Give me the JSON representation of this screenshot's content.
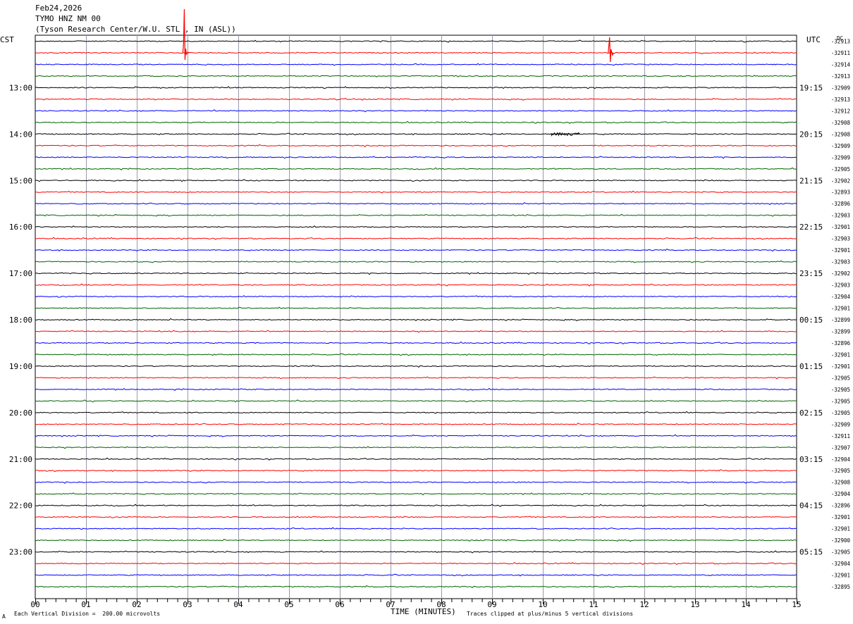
{
  "header": {
    "date": "Feb24,2026",
    "station": "TYMO HNZ NM 00",
    "location": "(Tyson Research Center/W.U. STL , IN (ASL))"
  },
  "left_tz": "CST",
  "right_tz": "UTC",
  "dc_label": "DC",
  "footer": {
    "scale_note": "Each Vertical Division =  200.00 microvolts",
    "clip_note": "Traces clipped at plus/minus 5 vertical divisions",
    "corner_mark": "A"
  },
  "chart_data": {
    "type": "line",
    "title": "",
    "xlabel": "TIME (MINUTES)",
    "xlim": [
      0,
      15
    ],
    "x_ticks": [
      "00",
      "01",
      "02",
      "03",
      "04",
      "05",
      "06",
      "07",
      "08",
      "09",
      "10",
      "11",
      "12",
      "13",
      "14",
      "15"
    ],
    "row_count": 48,
    "trace_color_cycle": [
      "#000000",
      "#ff0000",
      "#0000ff",
      "#006400"
    ],
    "left_hour_labels": [
      "13:00",
      "14:00",
      "15:00",
      "16:00",
      "17:00",
      "18:00",
      "19:00",
      "20:00",
      "21:00",
      "22:00",
      "23:00"
    ],
    "right_hour_labels": [
      "19:15",
      "20:15",
      "21:15",
      "22:15",
      "23:15",
      "00:15",
      "01:15",
      "02:15",
      "03:15",
      "04:15",
      "05:15"
    ],
    "dc_offsets": [
      "-32913",
      "-32911",
      "-32914",
      "-32913",
      "-32909",
      "-32913",
      "-32912",
      "-32908",
      "-32908",
      "-32909",
      "-32909",
      "-32905",
      "-32902",
      "-32893",
      "-32896",
      "-32903",
      "-32901",
      "-32903",
      "-32901",
      "-32903",
      "-32902",
      "-32903",
      "-32904",
      "-32901",
      "-32899",
      "-32899",
      "-32896",
      "-32901",
      "-32901",
      "-32905",
      "-32905",
      "-32905",
      "-32905",
      "-32909",
      "-32911",
      "-32907",
      "-32904",
      "-32905",
      "-32908",
      "-32904",
      "-32896",
      "-32901",
      "-32901",
      "-32900",
      "-32905",
      "-32904",
      "-32901",
      "-32895"
    ],
    "events": [
      {
        "row": 1,
        "minute": 2.95
      },
      {
        "row": 1,
        "minute": 11.33
      },
      {
        "row": 8,
        "minute": 10.45
      }
    ]
  }
}
